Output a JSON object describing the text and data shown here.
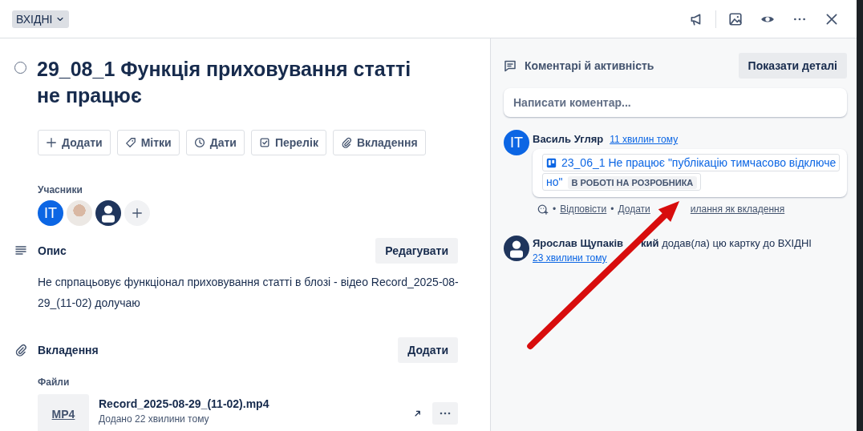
{
  "list_button": {
    "label": "ВХІДНІ"
  },
  "card": {
    "title": "29_08_1 Функція приховування статті не працює",
    "completed": false,
    "actions": [
      {
        "kind": "add",
        "label": "Додати"
      },
      {
        "kind": "labels",
        "label": "Мітки"
      },
      {
        "kind": "dates",
        "label": "Дати"
      },
      {
        "kind": "checklist",
        "label": "Перелік"
      },
      {
        "kind": "attachment",
        "label": "Вкладення"
      }
    ],
    "members": {
      "label": "Учасники",
      "avatars": [
        {
          "kind": "initials",
          "text": "IT"
        },
        {
          "kind": "photo"
        },
        {
          "kind": "silhouette"
        }
      ]
    },
    "description": {
      "heading": "Опис",
      "edit_button": "Редагувати",
      "text": "Не спрпацьовує функціонал приховування статті в блозі - відео Record_2025-08-29_(11-02) долучаю"
    },
    "attachments": {
      "heading": "Вкладення",
      "add_button": "Додати",
      "files_label": "Файли",
      "files": [
        {
          "type": "MP4",
          "name": "Record_2025-08-29_(11-02).mp4",
          "added": "Додано 22 хвилини тому"
        }
      ]
    }
  },
  "activity": {
    "heading": "Коментарі й активність",
    "details_button": "Показати деталі",
    "comment_placeholder": "Написати коментар...",
    "items": [
      {
        "kind": "comment",
        "avatar": {
          "kind": "initials",
          "text": "IT"
        },
        "author": "Василь Угляр",
        "time": "11 хвилин тому",
        "link_text": "23_06_1 Не працює \"публікацію тимчасово відключено\"",
        "status": "В РОБОТІ НА РОЗРОБНИКА",
        "actions": [
          {
            "separator": "•",
            "label": "Відповісти"
          },
          {
            "separator": "•",
            "label": "Додати"
          }
        ],
        "actions_after_arrow": [
          "илання як вкладення"
        ]
      },
      {
        "kind": "event",
        "avatar": {
          "kind": "silhouette"
        },
        "author_parts": [
          "Ярослав Щупаків",
          "кий"
        ],
        "text": "додав(ла) цю картку до ВХІДНІ",
        "time": "23 хвилини тому"
      }
    ]
  }
}
